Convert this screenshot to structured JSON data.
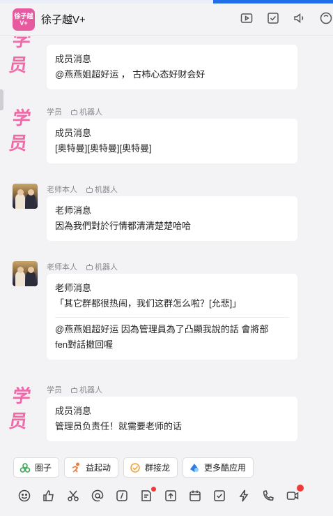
{
  "header": {
    "group_avatar_line1": "徐子越",
    "group_avatar_line2": "V+",
    "title": "徐子越V+",
    "icons": [
      "screen-share-icon",
      "checkbox-icon",
      "speaker-icon",
      "more-icon"
    ]
  },
  "messages": [
    {
      "avatar": "学员",
      "sender": "",
      "robot_label": "",
      "kind": "成员消息",
      "lines": [
        "@燕燕姐超好运 ， 古柿心态好财会好"
      ]
    },
    {
      "avatar": "学员",
      "sender": "学员",
      "robot_label": "机器人",
      "kind": "成员消息",
      "lines": [
        "[奥特曼][奥特曼][奥特曼]"
      ]
    },
    {
      "avatar": "teacher",
      "sender": "老师本人",
      "robot_label": "机器人",
      "kind": "老师消息",
      "lines": [
        "因為我們對於行情都清清楚楚哈哈"
      ]
    },
    {
      "avatar": "teacher",
      "sender": "老师本人",
      "robot_label": "机器人",
      "kind": "老师消息",
      "quote": "「其它群都很热闹，我们这群怎么啦？[允悲]」",
      "lines": [
        "@燕燕姐超好运 因為管理員為了凸顯我說的話 會將部",
        "fen對話撤回喔"
      ]
    },
    {
      "avatar": "学员",
      "sender": "学员",
      "robot_label": "机器人",
      "kind": "成员消息",
      "lines": [
        "管理员负责任！就需要老师的话"
      ]
    }
  ],
  "student_avatar_text": "学员",
  "chips": [
    {
      "label": "圈子",
      "icon": "circle-group-icon",
      "color": "#3aa856"
    },
    {
      "label": "益起动",
      "icon": "run-icon",
      "color": "#f07c3a"
    },
    {
      "label": "群接龙",
      "icon": "relay-icon",
      "color": "#f0a43a"
    },
    {
      "label": "更多酷应用",
      "icon": "apps-icon",
      "color": "#2f7ee8"
    }
  ],
  "toolbar": [
    "emoji-icon",
    "like-icon",
    "scissors-icon",
    "at-icon",
    "slash-icon",
    "doc-icon",
    "upload-icon",
    "calendar-icon",
    "todo-icon",
    "ding-icon",
    "phone-icon",
    "video-icon"
  ]
}
